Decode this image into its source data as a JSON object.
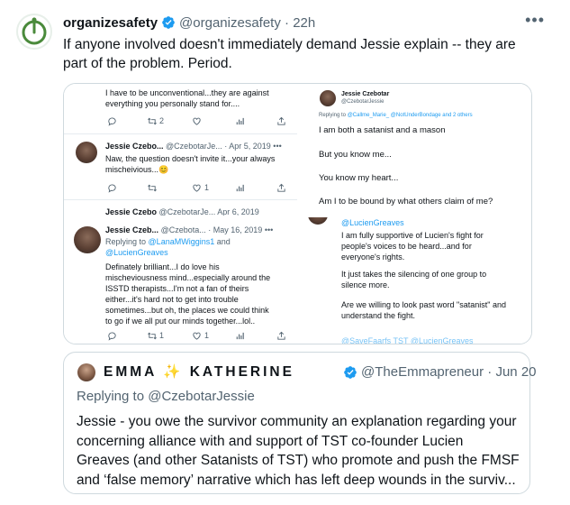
{
  "tweet": {
    "display_name": "organizesafety",
    "handle": "@organizesafety",
    "dot": "·",
    "time": "22h",
    "more": "•••",
    "text": "If anyone involved doesn't immediately demand Jessie explain -- they are part of the problem. Period."
  },
  "media": {
    "top_left": {
      "line1": "I have to be unconventional...they are against",
      "line2": "everything you personally stand for....",
      "retweets": "2",
      "reply_name": "Jessie Czebo...",
      "reply_handle": "@CzebotarJe...",
      "reply_date": "· Apr 5, 2019",
      "reply_line1": "Naw, the question doesn't invite it...your always",
      "reply_line2": "mischeivious...😊",
      "reply_likes": "1",
      "cut_name": "Jessie Czebo",
      "cut_handle": "@CzebotarJe...",
      "cut_date": "Apr 6, 2019"
    },
    "top_right": {
      "name": "Jessie Czebotar",
      "handle": "@CzebotarJessie",
      "replying_prefix": "Replying to",
      "replying_to": "@Callme_Marie_ @NotUnderBondage and 2 others",
      "line1": "I am both a satanist and a mason",
      "line2": "But you know me...",
      "line3": "You know my heart...",
      "line4": "Am I to be bound by what others claim of me?"
    },
    "bottom_left": {
      "name": "Jessie Czeb...",
      "handle": "@Czebota...",
      "date": "· May 16, 2019",
      "replying_prefix": "Replying to",
      "replying_to1": "@LanaMWiggins1",
      "replying_and": "and",
      "replying_to2": "@LucienGreaves",
      "lines": [
        "Definately brilliant...I do love his",
        "mischeviousness mind...especially around the",
        "ISSTD therapists...I'm not a fan of theirs",
        "either...it's hard not to get into trouble",
        "sometimes...but oh, the places we could think",
        "to go if we all put our minds together...lol.."
      ],
      "retweets": "1",
      "likes": "1"
    },
    "bottom_right": {
      "mention": "@LucienGreaves",
      "line1": "I am fully supportive of Lucien's fight for",
      "line2": "people's voices to be heard...and for",
      "line3": "everyone's rights.",
      "line4": "It just takes the silencing of one group to",
      "line5": "silence more.",
      "line6": "Are we willing to look past word \"satanist\" and",
      "line7": "understand the fight.",
      "cut_links": "@SaveFaarfs TST @LucienGreaves"
    }
  },
  "quote": {
    "display_name": "EMMA ✨ KATHERINE",
    "handle": "@TheEmmapreneur",
    "dot": "·",
    "date": "Jun 20",
    "replying_prefix": "Replying to",
    "replying_to": "@CzebotarJessie",
    "lines": [
      "Jessie - you owe the survivor community an explanation regarding your",
      "concerning alliance with and support of TST co-founder Lucien",
      "Greaves (and other Satanists of TST) who promote and push the FMSF",
      "and ‘false memory’ narrative which has left deep wounds in the surviv..."
    ]
  },
  "colors": {
    "accent": "#1d9bf0",
    "muted": "#536471",
    "text": "#0f1419",
    "logo_green": "#4a8a3b"
  },
  "icons": [
    "logo-icon",
    "verified-icon",
    "more-icon",
    "reply-icon",
    "retweet-icon",
    "like-icon",
    "views-icon",
    "share-icon"
  ]
}
